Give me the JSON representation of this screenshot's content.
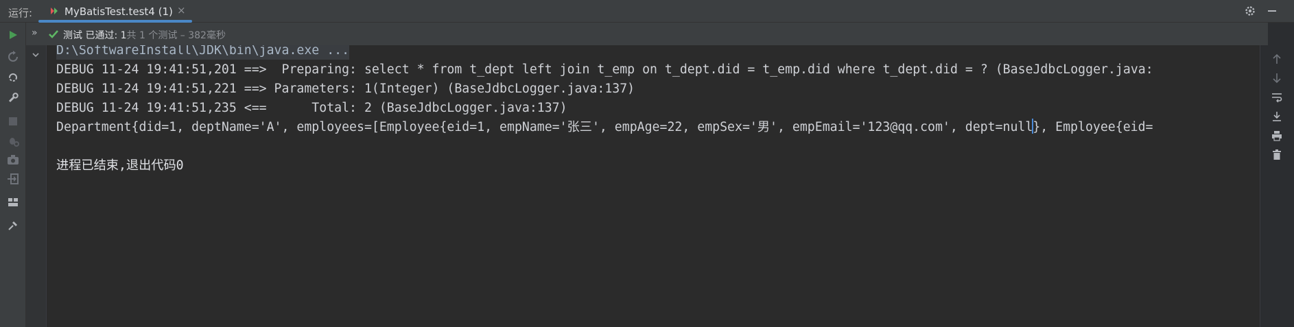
{
  "tabbar": {
    "run_label": "运行:",
    "tab_title": "MyBatisTest.test4 (1)",
    "close_glyph": "×",
    "right_icons": [
      "gear-icon",
      "minimize-icon"
    ]
  },
  "left_toolbar": {
    "icons": [
      "run-icon",
      "rerun-failed-icon",
      "toggle-auto-test-icon",
      "wrench-icon",
      "stop-icon",
      "debug-settings-icon",
      "camera-icon",
      "exit-icon",
      "layout-icon",
      "pin-icon"
    ]
  },
  "status": {
    "expand_glyph": "»",
    "passed_text": "测试 已通过: 1",
    "detail_text": "共 1 个测试 – 382毫秒"
  },
  "console": {
    "lines": [
      "D:\\SoftwareInstall\\JDK\\bin\\java.exe ...",
      "DEBUG 11-24 19:41:51,201 ==>  Preparing: select * from t_dept left join t_emp on t_dept.did = t_emp.did where t_dept.did = ? (BaseJdbcLogger.java:",
      "DEBUG 11-24 19:41:51,221 ==> Parameters: 1(Integer) (BaseJdbcLogger.java:137)",
      "DEBUG 11-24 19:41:51,235 <==      Total: 2 (BaseJdbcLogger.java:137)",
      "Department{did=1, deptName='A', employees=[Employee{eid=1, empName='张三', empAge=22, empSex='男', empEmail='123@qq.com', dept=null",
      "}, Employee{eid=",
      "进程已结束,退出代码0"
    ]
  },
  "right_toolbar": {
    "icons": [
      "scroll-up-icon",
      "scroll-down-icon",
      "soft-wrap-icon",
      "scroll-to-end-icon",
      "print-icon",
      "clear-icon"
    ]
  },
  "colors": {
    "accent": "#4a88c7",
    "passed_green": "#5fb865",
    "run_green": "#499c54",
    "caret": "#4b8bd8"
  }
}
